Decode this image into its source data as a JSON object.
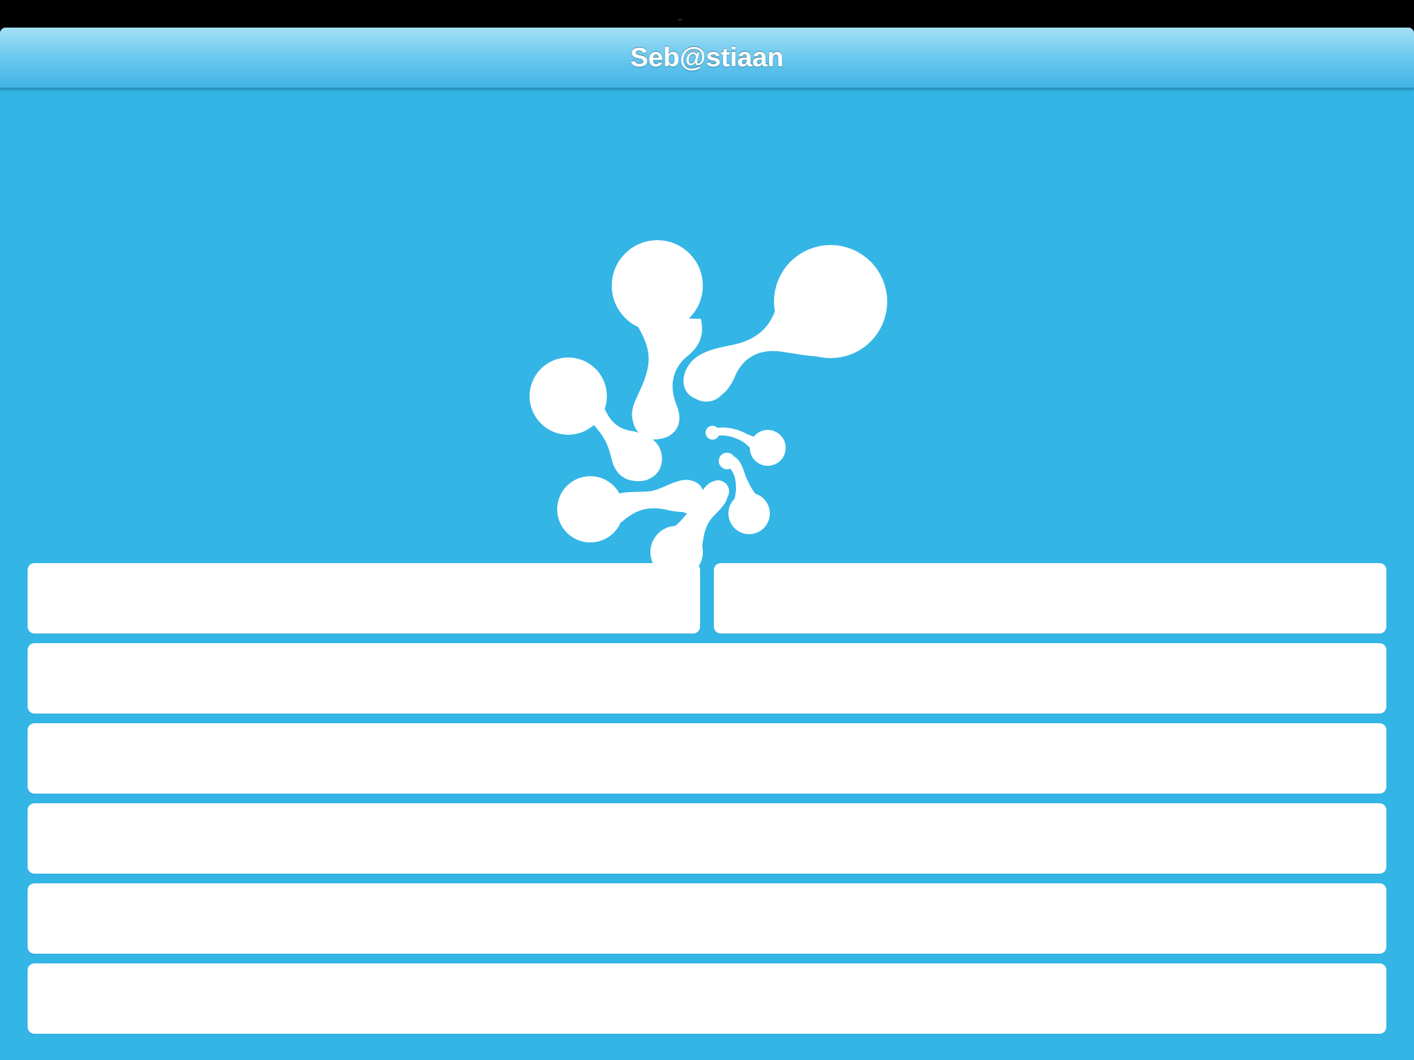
{
  "status_bar": {},
  "nav_bar": {
    "title": "Seb@stiaan"
  },
  "logo": {
    "icon": "molecule-splash-logo",
    "color": "#ffffff"
  },
  "colors": {
    "background": "#33b5e6",
    "nav_gradient_top": "#a5e0f6",
    "nav_gradient_bottom": "#3fb3e5",
    "button_fill": "#ffffff"
  },
  "buttons": {
    "row1_left": {
      "label": ""
    },
    "row1_right": {
      "label": ""
    },
    "row2": {
      "label": ""
    },
    "row3": {
      "label": ""
    },
    "row4": {
      "label": ""
    },
    "row5": {
      "label": ""
    },
    "row6": {
      "label": ""
    }
  }
}
